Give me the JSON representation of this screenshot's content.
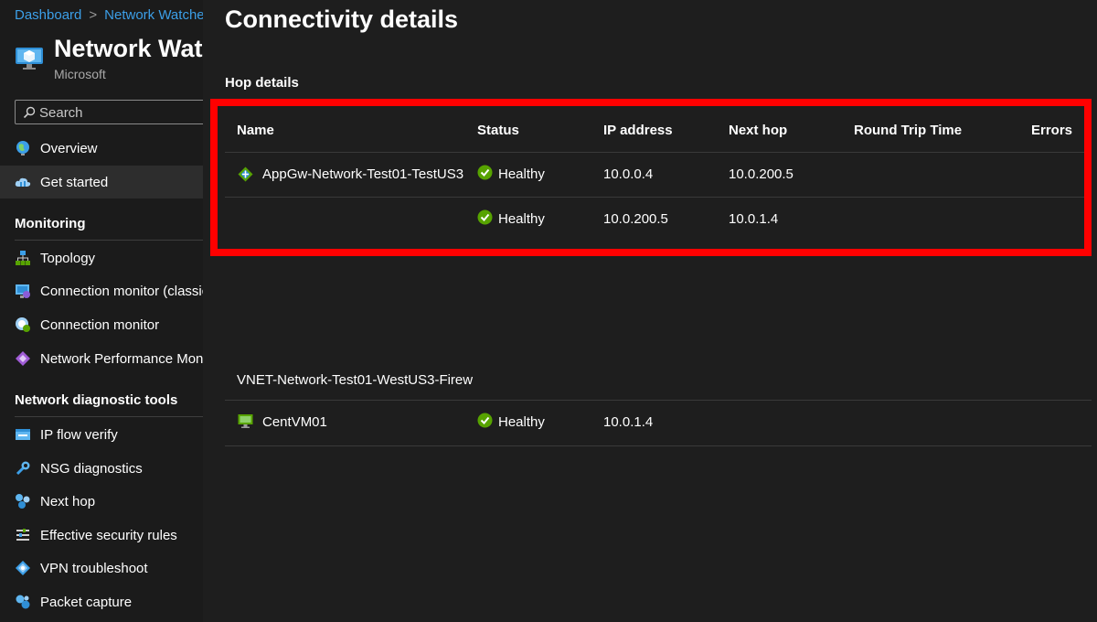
{
  "breadcrumb": [
    "Dashboard",
    "Network Watcher"
  ],
  "resource": {
    "title": "Network Watcher",
    "subtitle": "Microsoft"
  },
  "search": {
    "placeholder": "Search"
  },
  "sidebar": {
    "items": [
      {
        "label": "Overview",
        "icon": "globe-icon"
      },
      {
        "label": "Get started",
        "icon": "cloud-icon"
      }
    ],
    "sections": [
      {
        "title": "Monitoring",
        "items": [
          {
            "label": "Topology",
            "icon": "topology-icon"
          },
          {
            "label": "Connection monitor (classic)",
            "icon": "connection-monitor-classic-icon"
          },
          {
            "label": "Connection monitor",
            "icon": "connection-monitor-icon"
          },
          {
            "label": "Network Performance Monitor",
            "icon": "network-performance-icon"
          }
        ]
      },
      {
        "title": "Network diagnostic tools",
        "items": [
          {
            "label": "IP flow verify",
            "icon": "ip-flow-icon"
          },
          {
            "label": "NSG diagnostics",
            "icon": "nsg-diagnostics-icon"
          },
          {
            "label": "Next hop",
            "icon": "next-hop-icon"
          },
          {
            "label": "Effective security rules",
            "icon": "security-rules-icon"
          },
          {
            "label": "VPN troubleshoot",
            "icon": "vpn-icon"
          },
          {
            "label": "Packet capture",
            "icon": "packet-capture-icon"
          }
        ]
      }
    ]
  },
  "main": {
    "title": "Connectivity details",
    "hop_details_heading": "Hop details",
    "columns": [
      "Name",
      "Status",
      "IP address",
      "Next hop",
      "Round Trip Time",
      "Errors"
    ],
    "rows": [
      {
        "name": "AppGw-Network-Test01-TestUS3",
        "status": "Healthy",
        "ip": "10.0.0.4",
        "next_hop": "10.0.200.5"
      },
      {
        "name": "",
        "status": "Healthy",
        "ip": "10.0.200.5",
        "next_hop": "10.0.1.4"
      }
    ],
    "group_label": "VNET-Network-Test01-WestUS3-Firew",
    "group_rows": [
      {
        "name": "CentVM01",
        "status": "Healthy",
        "ip": "10.0.1.4"
      }
    ]
  },
  "colors": {
    "link": "#3c9fe8",
    "healthy": "#57a300",
    "highlight": "#ff0000",
    "background": "#1e1e1e"
  }
}
